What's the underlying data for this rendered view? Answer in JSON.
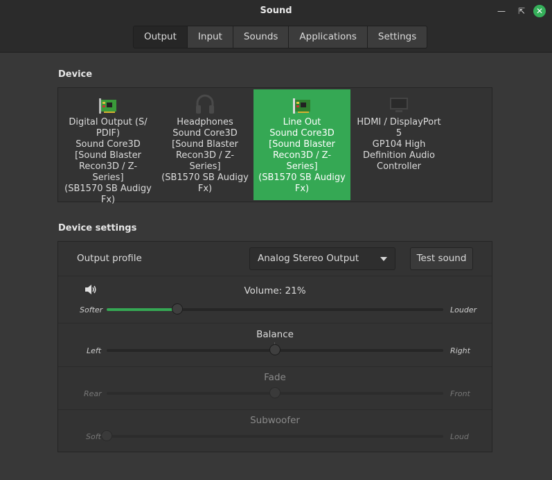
{
  "window": {
    "title": "Sound"
  },
  "tabs": [
    {
      "label": "Output",
      "active": true
    },
    {
      "label": "Input",
      "active": false
    },
    {
      "label": "Sounds",
      "active": false
    },
    {
      "label": "Applications",
      "active": false
    },
    {
      "label": "Settings",
      "active": false
    }
  ],
  "device_section": {
    "title": "Device"
  },
  "devices": [
    {
      "name": "Digital Output (S/\nPDIF)\nSound Core3D\n[Sound Blaster\nRecon3D / Z-Series]\n(SB1570 SB Audigy\nFx)",
      "icon": "sound-card-icon",
      "selected": false
    },
    {
      "name": "Headphones\nSound Core3D\n[Sound Blaster\nRecon3D / Z-Series]\n(SB1570 SB Audigy\nFx)",
      "icon": "headphones-icon",
      "selected": false
    },
    {
      "name": "Line Out\nSound Core3D\n[Sound Blaster\nRecon3D / Z-Series]\n(SB1570 SB Audigy\nFx)",
      "icon": "sound-card-icon",
      "selected": true
    },
    {
      "name": "HDMI / DisplayPort\n5\nGP104 High\nDefinition Audio\nController",
      "icon": "monitor-icon",
      "selected": false
    }
  ],
  "settings_section": {
    "title": "Device settings"
  },
  "output_profile": {
    "label": "Output profile",
    "value": "Analog Stereo Output",
    "test_label": "Test sound"
  },
  "volume": {
    "label": "Volume: 21%",
    "min_label": "Softer",
    "max_label": "Louder",
    "value_percent": 21
  },
  "balance": {
    "label": "Balance",
    "min_label": "Left",
    "max_label": "Right",
    "value": 0.5
  },
  "fade": {
    "label": "Fade",
    "min_label": "Rear",
    "max_label": "Front",
    "value": 0.5
  },
  "subwoofer": {
    "label": "Subwoofer",
    "min_label": "Soft",
    "max_label": "Loud",
    "value": 0
  },
  "colors": {
    "accent": "#35a854",
    "close": "#35b05a",
    "background": "#383838"
  }
}
